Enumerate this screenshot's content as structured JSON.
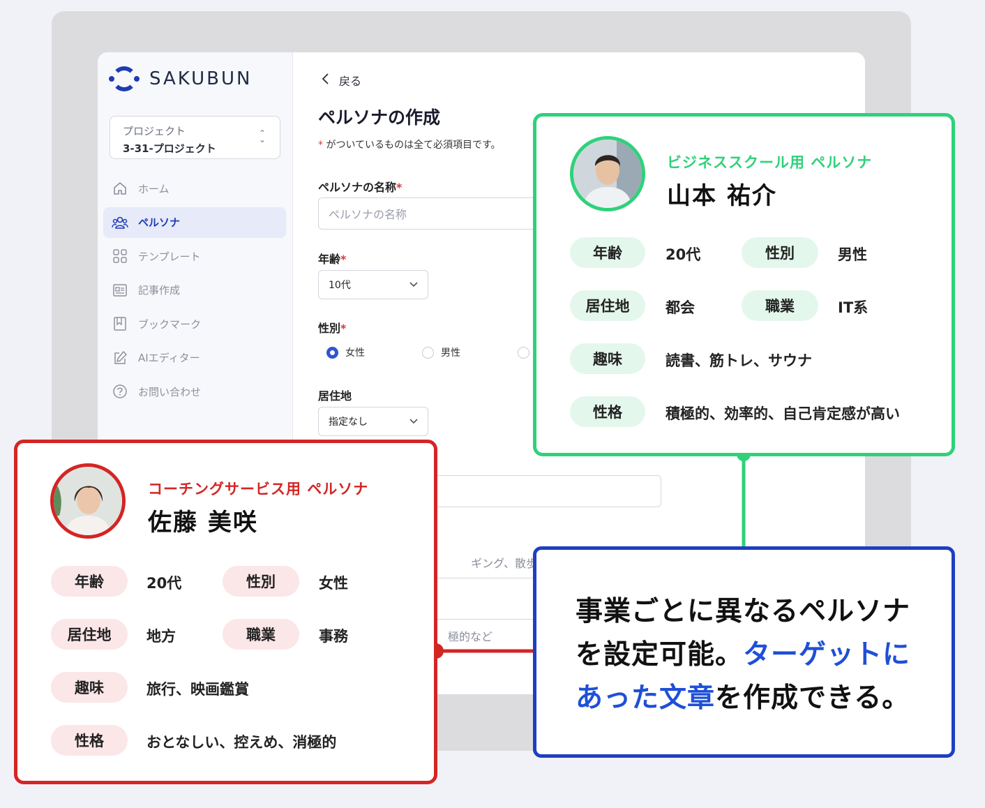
{
  "sidebar": {
    "logo_text": "SAKUBUN",
    "project": {
      "label": "プロジェクト",
      "value": "3-31-プロジェクト"
    },
    "items": [
      {
        "label": "ホーム",
        "icon": "home-icon",
        "active": false
      },
      {
        "label": "ペルソナ",
        "icon": "users-icon",
        "active": true
      },
      {
        "label": "テンプレート",
        "icon": "grid-icon",
        "active": false
      },
      {
        "label": "記事作成",
        "icon": "article-icon",
        "active": false
      },
      {
        "label": "ブックマーク",
        "icon": "bookmark-icon",
        "active": false
      },
      {
        "label": "AIエディター",
        "icon": "edit-icon",
        "active": false
      },
      {
        "label": "お問い合わせ",
        "icon": "help-icon",
        "active": false
      }
    ]
  },
  "form": {
    "back_label": "戻る",
    "title": "ペルソナの作成",
    "required_note": "がついているものは全て必須項目です。",
    "required_mark": "*",
    "name_label": "ペルソナの名称",
    "name_placeholder": "ペルソナの名称",
    "age_label": "年齢",
    "age_value": "10代",
    "gender_label": "性別",
    "gender_options": [
      "女性",
      "男性"
    ],
    "gender_selected": "女性",
    "residence_label": "居住地",
    "residence_value": "指定なし",
    "hobby_placeholder_fragment": "ギング、散歩など",
    "personality_placeholder_fragment": "極的など"
  },
  "green_card": {
    "subtitle": "ビジネススクール用 ペルソナ",
    "name": "山本 祐介",
    "rows": [
      {
        "k1": "年齢",
        "v1": "20代",
        "k2": "性別",
        "v2": "男性"
      },
      {
        "k1": "居住地",
        "v1": "都会",
        "k2": "職業",
        "v2": "IT系"
      }
    ],
    "hobby_label": "趣味",
    "hobby_value": "読書、筋トレ、サウナ",
    "personality_label": "性格",
    "personality_value": "積極的、効率的、自己肯定感が高い"
  },
  "red_card": {
    "subtitle": "コーチングサービス用 ペルソナ",
    "name": "佐藤 美咲",
    "rows": [
      {
        "k1": "年齢",
        "v1": "20代",
        "k2": "性別",
        "v2": "女性"
      },
      {
        "k1": "居住地",
        "v1": "地方",
        "k2": "職業",
        "v2": "事務"
      }
    ],
    "hobby_label": "趣味",
    "hobby_value": "旅行、映画鑑賞",
    "personality_label": "性格",
    "personality_value": "おとなしい、控えめ、消極的"
  },
  "blue_card": {
    "text_1": "事業ごとに異なるペルソナを設定可能。",
    "text_highlight": "ターゲットにあった文章",
    "text_2": "を作成できる。"
  },
  "colors": {
    "green": "#2fd17a",
    "red": "#d42525",
    "blue": "#1e3fc2",
    "brand": "#1f3bb3"
  }
}
